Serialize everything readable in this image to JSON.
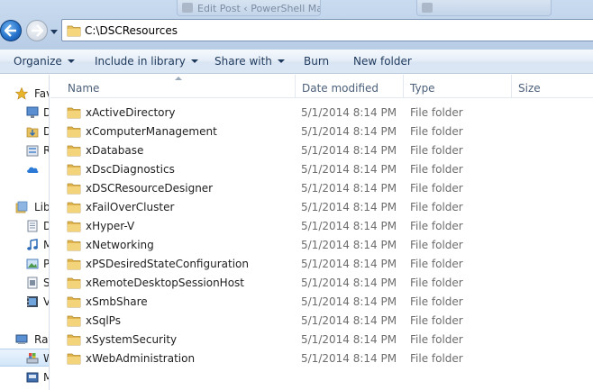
{
  "background_tabs": [
    {
      "label": "Edit Post ‹ PowerShell Ma..."
    },
    {
      "label": ""
    }
  ],
  "address": {
    "path": "C:\\DSCResources"
  },
  "commandbar": {
    "organize": "Organize",
    "include_in_library": "Include in library",
    "share_with": "Share with",
    "burn": "Burn",
    "new_folder": "New folder"
  },
  "nav_pane": {
    "favorites": "Fav",
    "fav_items": [
      "D",
      "D",
      "R"
    ],
    "libraries": "Libr",
    "lib_items": [
      "D",
      "M",
      "P",
      "S",
      "V"
    ],
    "group3": "Ray",
    "group3_items": [
      "W",
      "M"
    ]
  },
  "columns": {
    "name": "Name",
    "date_modified": "Date modified",
    "type": "Type",
    "size": "Size"
  },
  "files": [
    {
      "name": "xActiveDirectory",
      "date": "5/1/2014 8:14 PM",
      "type": "File folder"
    },
    {
      "name": "xComputerManagement",
      "date": "5/1/2014 8:14 PM",
      "type": "File folder"
    },
    {
      "name": "xDatabase",
      "date": "5/1/2014 8:14 PM",
      "type": "File folder"
    },
    {
      "name": "xDscDiagnostics",
      "date": "5/1/2014 8:14 PM",
      "type": "File folder"
    },
    {
      "name": "xDSCResourceDesigner",
      "date": "5/1/2014 8:14 PM",
      "type": "File folder"
    },
    {
      "name": "xFailOverCluster",
      "date": "5/1/2014 8:14 PM",
      "type": "File folder"
    },
    {
      "name": "xHyper-V",
      "date": "5/1/2014 8:14 PM",
      "type": "File folder"
    },
    {
      "name": "xNetworking",
      "date": "5/1/2014 8:14 PM",
      "type": "File folder"
    },
    {
      "name": "xPSDesiredStateConfiguration",
      "date": "5/1/2014 8:14 PM",
      "type": "File folder"
    },
    {
      "name": "xRemoteDesktopSessionHost",
      "date": "5/1/2014 8:14 PM",
      "type": "File folder"
    },
    {
      "name": "xSmbShare",
      "date": "5/1/2014 8:14 PM",
      "type": "File folder"
    },
    {
      "name": "xSqlPs",
      "date": "5/1/2014 8:14 PM",
      "type": "File folder"
    },
    {
      "name": "xSystemSecurity",
      "date": "5/1/2014 8:14 PM",
      "type": "File folder"
    },
    {
      "name": "xWebAdministration",
      "date": "5/1/2014 8:14 PM",
      "type": "File folder"
    }
  ],
  "colors": {
    "accent": "#1e395b",
    "folder": "#e8c260"
  }
}
